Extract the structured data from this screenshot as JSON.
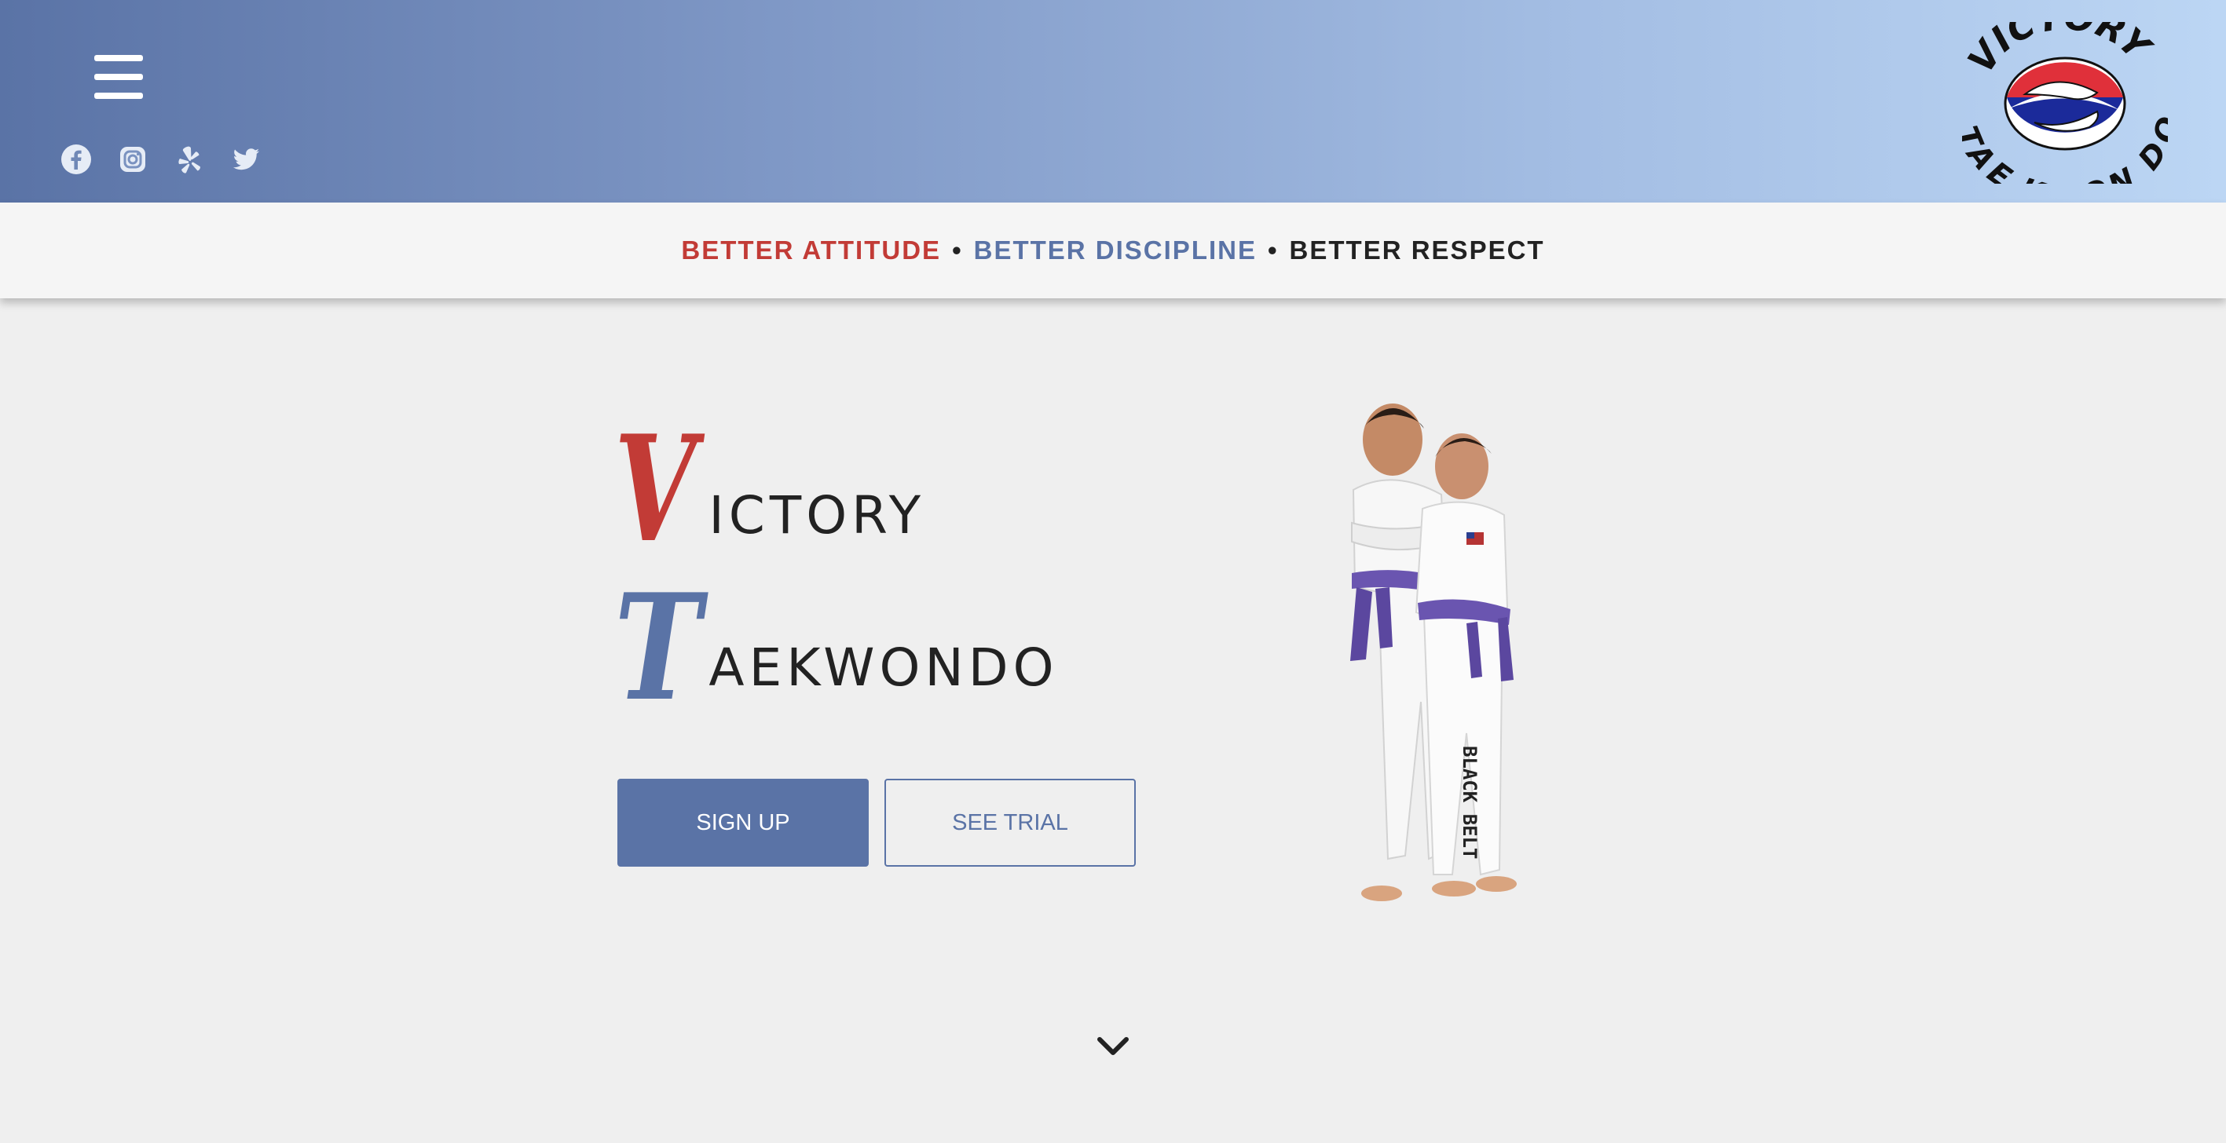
{
  "header": {
    "menu_icon": "hamburger-menu-icon",
    "socials": [
      {
        "name": "facebook",
        "icon": "facebook-icon"
      },
      {
        "name": "instagram",
        "icon": "instagram-icon"
      },
      {
        "name": "yelp",
        "icon": "yelp-icon"
      },
      {
        "name": "twitter",
        "icon": "twitter-icon"
      }
    ],
    "logo": {
      "top_text": "VICTORY",
      "bottom_text": "TAE KWON DO"
    }
  },
  "tagline": {
    "part1": "BETTER ATTITUDE",
    "separator": "•",
    "part2": "BETTER DISCIPLINE",
    "part3": "BETTER RESPECT"
  },
  "hero": {
    "line1_initial": "V",
    "line1_rest": "ICTORY",
    "line2_initial": "T",
    "line2_rest": "AEKWONDO",
    "signup_label": "SIGN UP",
    "trial_label": "SEE TRIAL",
    "photo_belt_text": "BLACK BELT"
  },
  "colors": {
    "brand_red": "#c23b36",
    "brand_blue": "#5a73a6",
    "dark_text": "#222222",
    "background": "#efefef"
  },
  "scroll_icon": "chevron-down-icon"
}
